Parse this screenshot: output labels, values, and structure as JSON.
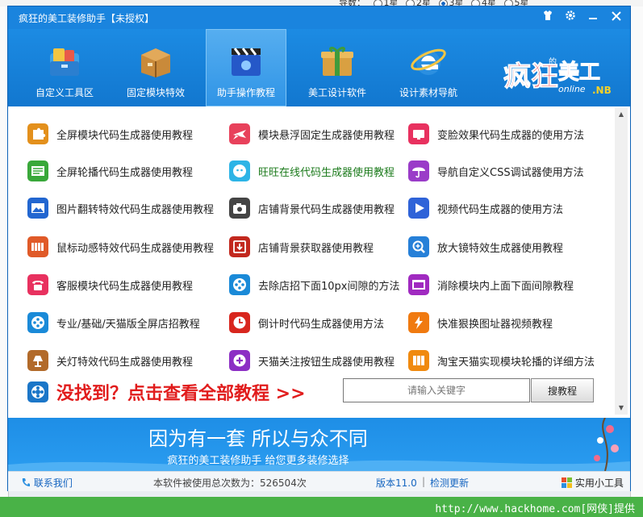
{
  "background": {
    "radio_prefix": "导数：",
    "radio_options": [
      "1星",
      "2星",
      "3星",
      "4星",
      "5星"
    ],
    "selected_radio": "3星"
  },
  "window": {
    "title": "疯狂的美工装修助手【未授权】"
  },
  "toolbar": {
    "items": [
      {
        "label": "自定义工具区",
        "icon": "toolbox-icon"
      },
      {
        "label": "固定模块特效",
        "icon": "package-box-icon"
      },
      {
        "label": "助手操作教程",
        "icon": "clapperboard-icon"
      },
      {
        "label": "美工设计软件",
        "icon": "gift-box-icon"
      },
      {
        "label": "设计素材导航",
        "icon": "internet-explorer-icon"
      }
    ],
    "active": "助手操作教程",
    "logo_text": "疯狂的美工",
    "logo_sub": "online.NB"
  },
  "tutorials": [
    {
      "label": "全屏模块代码生成器使用教程",
      "icon": "puzzle-icon",
      "color": "#e3901c"
    },
    {
      "label": "模块悬浮固定生成器使用教程",
      "icon": "airplane-icon",
      "color": "#e8415b"
    },
    {
      "label": "变脸效果代码生成器的使用方法",
      "icon": "screen-icon",
      "color": "#e8315f"
    },
    {
      "label": "全屏轮播代码生成器使用教程",
      "icon": "slides-icon",
      "color": "#39a83a"
    },
    {
      "label": "旺旺在线代码生成器使用教程",
      "icon": "chat-face-icon",
      "color": "#2db4e6"
    },
    {
      "label": "导航自定义CSS调试器使用方法",
      "icon": "umbrella-icon",
      "color": "#9a3cc8"
    },
    {
      "label": "图片翻转特效代码生成器使用教程",
      "icon": "image-icon",
      "color": "#2266d0"
    },
    {
      "label": "店铺背景代码生成器使用教程",
      "icon": "camera-icon",
      "color": "#444444"
    },
    {
      "label": "视频代码生成器的使用方法",
      "icon": "play-icon",
      "color": "#2f63d8"
    },
    {
      "label": "鼠标动感特效代码生成器使用教程",
      "icon": "keys-icon",
      "color": "#e05a28"
    },
    {
      "label": "店铺背景获取器使用教程",
      "icon": "download-icon",
      "color": "#c2281e"
    },
    {
      "label": "放大镜特效生成器使用教程",
      "icon": "magnifier-icon",
      "color": "#2680d8"
    },
    {
      "label": "客服模块代码生成器使用教程",
      "icon": "phone-icon",
      "color": "#e8315f"
    },
    {
      "label": "去除店招下面10px间隙的方法",
      "icon": "film-reel-icon",
      "color": "#1a8ad8"
    },
    {
      "label": "消除模块内上面下面间隙教程",
      "icon": "window-icon",
      "color": "#a02ac0"
    },
    {
      "label": "专业/基础/天猫版全屏店招教程",
      "icon": "film-reel-icon",
      "color": "#1a8ad8"
    },
    {
      "label": "倒计时代码生成器使用方法",
      "icon": "clock-icon",
      "color": "#d8261e"
    },
    {
      "label": "快准狠换图址器视频教程",
      "icon": "lightning-icon",
      "color": "#f07a10"
    },
    {
      "label": "关灯特效代码生成器使用教程",
      "icon": "lamp-icon",
      "color": "#b26a2a"
    },
    {
      "label": "天猫关注按钮生成器使用教程",
      "icon": "plus-circle-icon",
      "color": "#8c2ec4"
    },
    {
      "label": "淘宝天猫实现模块轮播的详细方法",
      "icon": "grid-icon",
      "color": "#f08a10"
    }
  ],
  "not_found": {
    "label": "没找到？点击查看全部教程 >>",
    "icon": "film-reel-icon"
  },
  "search": {
    "placeholder": "请输入关键字",
    "button": "搜教程"
  },
  "banner": {
    "slogan": "因为有一套 所以与众不同",
    "subslogan": "疯狂的美工装修助手 给您更多装修选择"
  },
  "status": {
    "contact": "联系我们",
    "usage_label": "本软件被使用总次数为：",
    "usage_count": "526504次",
    "version": "版本11.0",
    "separator": "|",
    "check_update": "检测更新",
    "tools": "实用小工具"
  },
  "footer": {
    "url_text": "http://www.hackhome.com[网侠]提供"
  }
}
